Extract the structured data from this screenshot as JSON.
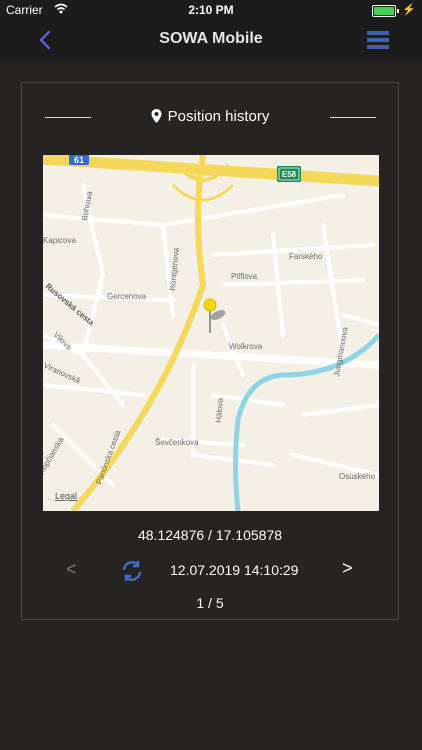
{
  "status_bar": {
    "carrier": "Carrier",
    "time": "2:10 PM",
    "battery_color": "#3cd450"
  },
  "nav": {
    "title": "SOWA Mobile",
    "back_icon": "chevron-left-icon",
    "menu_icon": "hamburger-menu-icon",
    "accent": "#3f5fa8"
  },
  "card": {
    "header_icon": "location-pin-icon",
    "header_title": "Position history",
    "map": {
      "road_badges": [
        "61",
        "E58"
      ],
      "street_labels": [
        "Kapicova",
        "Bohrova",
        "Gercenova",
        "Röntgenova",
        "Pifflova",
        "Farského",
        "Jungmannova",
        "Rusovská cesta",
        "Vilová",
        "Wolkrova",
        "Hálova",
        "Ševčenkova",
        "Panónska cesta",
        "Osuského",
        "Kopčianska",
        "Viranovská"
      ],
      "legal": "Legal",
      "marker_color": "#f5d90a",
      "river_color": "#8fd3e6"
    },
    "coordinates": "48.124876 / 17.105878",
    "controls": {
      "prev_label": "<",
      "next_label": ">",
      "refresh_icon": "refresh-icon",
      "datetime": "12.07.2019 14:10:29"
    },
    "page_indicator": "1 / 5"
  }
}
